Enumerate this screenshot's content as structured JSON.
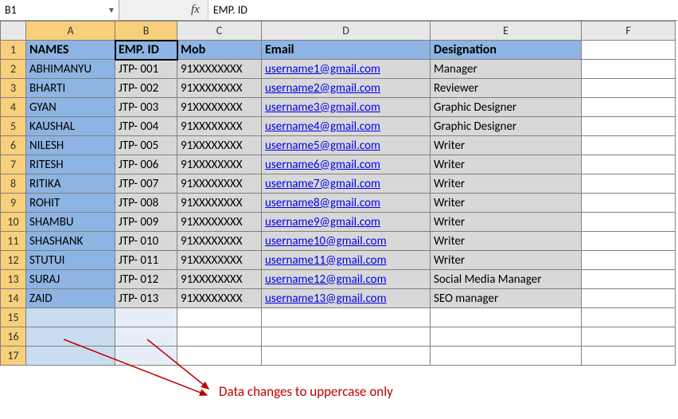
{
  "formula_bar": {
    "name_box": "B1",
    "fx_label": "fx",
    "formula": "EMP. ID"
  },
  "columns": [
    "A",
    "B",
    "C",
    "D",
    "E",
    "F"
  ],
  "row_count": 17,
  "headers": {
    "A": "NAMES",
    "B": "EMP. ID",
    "C": "Mob",
    "D": "Email",
    "E": "Designation"
  },
  "rows": [
    {
      "name": "ABHIMANYU",
      "emp": "JTP- 001",
      "mob": "91XXXXXXXX",
      "email": "username1@gmail.com",
      "desig": "Manager"
    },
    {
      "name": "BHARTI",
      "emp": "JTP- 002",
      "mob": "91XXXXXXXX",
      "email": "username2@gmail.com",
      "desig": "Reviewer"
    },
    {
      "name": "GYAN",
      "emp": "JTP- 003",
      "mob": "91XXXXXXXX",
      "email": "username3@gmail.com",
      "desig": "Graphic Designer"
    },
    {
      "name": "KAUSHAL",
      "emp": "JTP- 004",
      "mob": "91XXXXXXXX",
      "email": "username4@gmail.com",
      "desig": "Graphic Designer"
    },
    {
      "name": "NILESH",
      "emp": "JTP- 005",
      "mob": "91XXXXXXXX",
      "email": "username5@gmail.com",
      "desig": "Writer"
    },
    {
      "name": "RITESH",
      "emp": "JTP- 006",
      "mob": "91XXXXXXXX",
      "email": "username6@gmail.com",
      "desig": "Writer"
    },
    {
      "name": "RITIKA",
      "emp": "JTP- 007",
      "mob": "91XXXXXXXX",
      "email": "username7@gmail.com",
      "desig": "Writer"
    },
    {
      "name": "ROHIT",
      "emp": "JTP- 008",
      "mob": "91XXXXXXXX",
      "email": "username8@gmail.com",
      "desig": "Writer"
    },
    {
      "name": "SHAMBU",
      "emp": "JTP- 009",
      "mob": "91XXXXXXXX",
      "email": "username9@gmail.com",
      "desig": "Writer"
    },
    {
      "name": "SHASHANK",
      "emp": "JTP- 010",
      "mob": "91XXXXXXXX",
      "email": "username10@gmail.com",
      "desig": "Writer"
    },
    {
      "name": "STUTUI",
      "emp": "JTP- 011",
      "mob": "91XXXXXXXX",
      "email": "username11@gmail.com",
      "desig": "Writer"
    },
    {
      "name": "SURAJ",
      "emp": "JTP- 012",
      "mob": "91XXXXXXXX",
      "email": "username12@gmail.com",
      "desig": "Social Media Manager"
    },
    {
      "name": "ZAID",
      "emp": "JTP- 013",
      "mob": "91XXXXXXXX",
      "email": "username13@gmail.com",
      "desig": "SEO manager"
    }
  ],
  "annotation": {
    "text": "Data changes to uppercase only"
  }
}
